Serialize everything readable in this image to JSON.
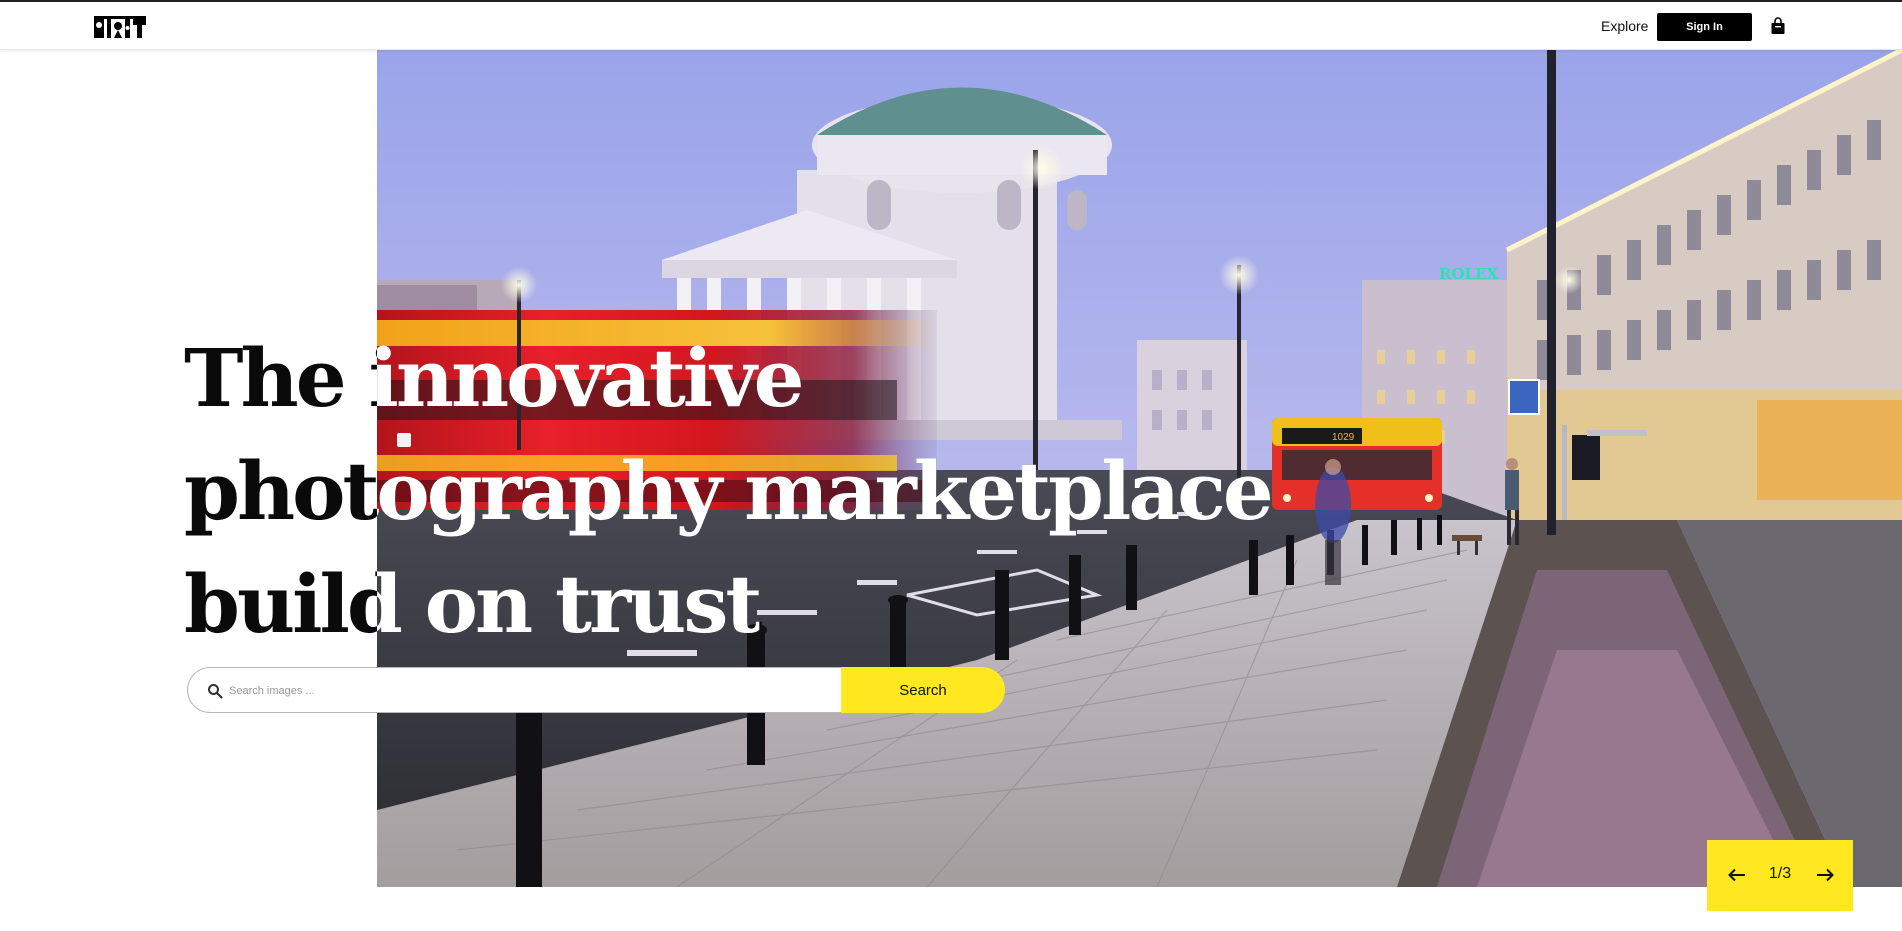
{
  "header": {
    "logo_alt": "PIT",
    "nav": {
      "explore_label": "Explore"
    },
    "signin_label": "Sign In",
    "cart_icon": "shopping-bag-icon"
  },
  "hero": {
    "headline_lines": [
      "The innovative",
      "photography marketplace",
      "build on trust"
    ],
    "photo_sign_text": "ROLEX",
    "photo_bus_number": "1029"
  },
  "search": {
    "placeholder": "Search images ...",
    "button_label": "Search",
    "icon": "search-icon"
  },
  "slider": {
    "counter": "1/3",
    "current": 1,
    "total": 3,
    "prev_icon": "arrow-left-icon",
    "next_icon": "arrow-right-icon"
  },
  "colors": {
    "accent": "#ffe81f",
    "header_button": "#000000",
    "background": "#ffffff"
  }
}
